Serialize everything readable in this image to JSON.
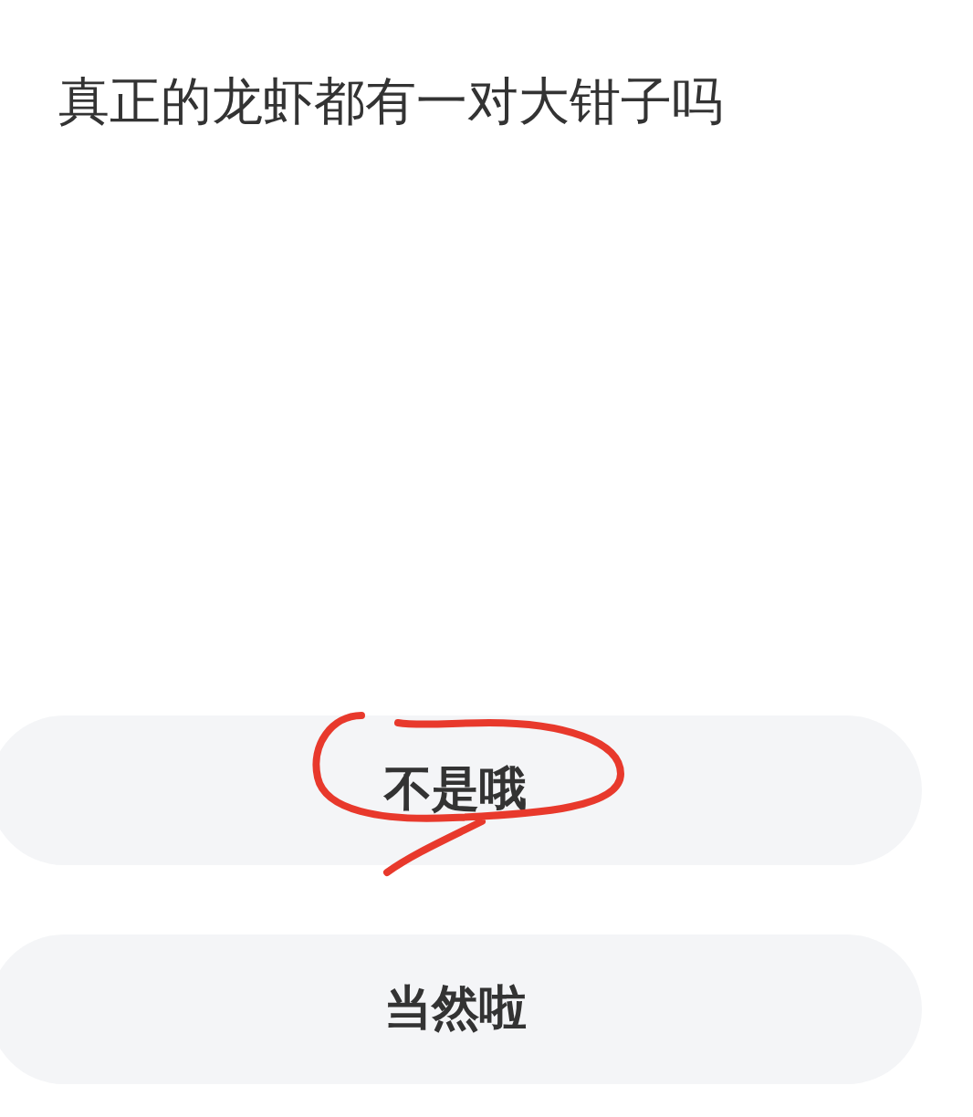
{
  "question": "真正的龙虾都有一对大钳子吗",
  "options": [
    {
      "label": "不是哦",
      "circled": true
    },
    {
      "label": "当然啦",
      "circled": false
    }
  ]
}
